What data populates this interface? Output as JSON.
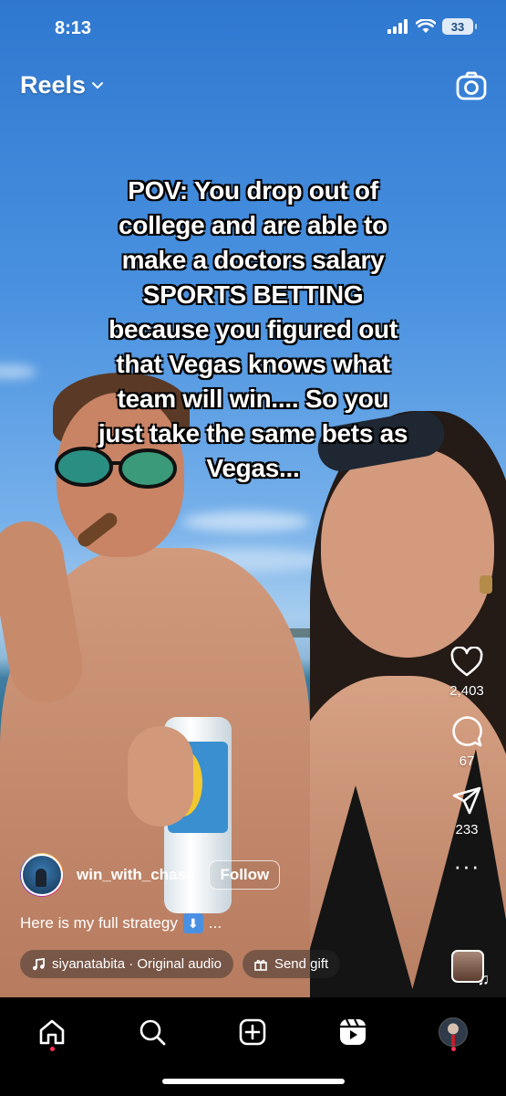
{
  "status_bar": {
    "time": "8:13",
    "battery": "33"
  },
  "header": {
    "title": "Reels"
  },
  "video": {
    "caption_overlay": "POV: You drop out of\ncollege and are able to\nmake a doctors salary\nSPORTS  BETTING\nbecause you figured out\nthat Vegas knows what\nteam will win.... So you\njust take the same bets as\nVegas..."
  },
  "actions": {
    "likes": "2,403",
    "comments": "67",
    "shares": "233"
  },
  "author": {
    "username": "win_with_chase",
    "follow_label": "Follow"
  },
  "post": {
    "caption": "Here is my full strategy",
    "ellipsis": "..."
  },
  "audio": {
    "label": "siyanatabita · Original audio"
  },
  "gift": {
    "label": "Send gift"
  },
  "colors": {
    "nav_dot": "#ff2e55",
    "nav_background": "#000000"
  }
}
